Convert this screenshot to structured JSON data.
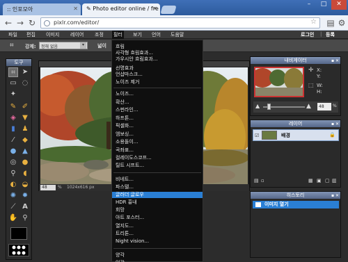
{
  "browser": {
    "tabs": [
      {
        "label": ":: 인포모아",
        "active": false
      },
      {
        "label": "Photo editor online / fre",
        "active": true
      }
    ],
    "url": "pixlr.com/editor/"
  },
  "menubar": {
    "items": [
      "파일",
      "편집",
      "이미지",
      "레이어",
      "조정",
      "필터",
      "보기",
      "언어",
      "도움말"
    ],
    "open_item": "필터",
    "login": "로그인",
    "register": "등록"
  },
  "options": {
    "label_strength": "강제:",
    "mode_value": "정해 없음",
    "partial_label": "넓이"
  },
  "tools_panel": {
    "title": "도구"
  },
  "canvas": {
    "zoom": "48",
    "zoom_unit": "%",
    "dimensions": "1024x616 px"
  },
  "filter_menu": {
    "groups": [
      [
        "흐림",
        "사각형 흐림효과...",
        "가우시안 흐림효과...",
        "선명효과",
        "언샵마스크...",
        "노이즈 제거"
      ],
      [
        "노이즈...",
        "확산...",
        "스펀라인...",
        "하프톤...",
        "픽셀화...",
        "엠보싱...",
        "소용돌이...",
        "곡좌표...",
        "컬레이도스코프...",
        "틸트 시프트..."
      ],
      [
        "비네트...",
        "파스텔...",
        "글러더 글로우",
        "HDR 흉내",
        "회망",
        "아트 포스터...",
        "열지도...",
        "트리톤...",
        "Night vision..."
      ],
      [
        "양각",
        "인각"
      ]
    ],
    "highlighted": "글러더 글로우"
  },
  "navigator": {
    "title": "내비게이터",
    "x_label": "X:",
    "y_label": "Y:",
    "w_label": "W:",
    "h_label": "H:",
    "zoom": "48",
    "zoom_unit": "%"
  },
  "layers": {
    "title": "레이어",
    "items": [
      {
        "name": "배경"
      }
    ]
  },
  "history": {
    "title": "히스토리",
    "items": [
      {
        "name": "이미지 열기"
      }
    ]
  }
}
